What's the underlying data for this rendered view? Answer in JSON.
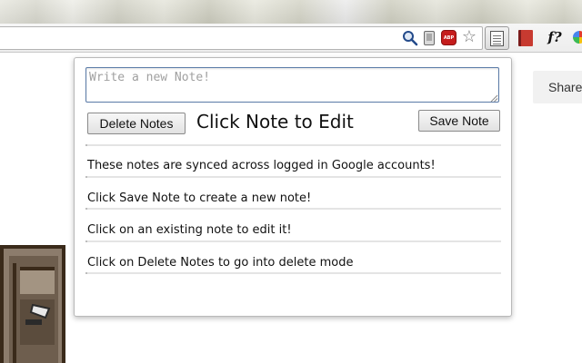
{
  "toolbar": {
    "icons": [
      "search-icon",
      "phone-icon",
      "abp-icon",
      "star-icon",
      "notes-extension-icon",
      "book-icon",
      "f-question-icon",
      "colorful-pin-icon"
    ],
    "abp_label": "ABP",
    "f_label": "f?"
  },
  "page": {
    "share_label": "Share"
  },
  "popup": {
    "input": {
      "placeholder": "Write a new Note!",
      "value": ""
    },
    "delete_label": "Delete Notes",
    "hint": "Click Note to Edit",
    "save_label": "Save Note",
    "notes": [
      "These notes are synced across logged in Google accounts!",
      "Click Save Note to create a new note!",
      "Click on an existing note to edit it!",
      "Click on Delete Notes to go into delete mode"
    ]
  },
  "colors": {
    "input_border": "#5b7ba8",
    "abp_red": "#c51d1d",
    "popup_border": "#b9b9b9"
  }
}
